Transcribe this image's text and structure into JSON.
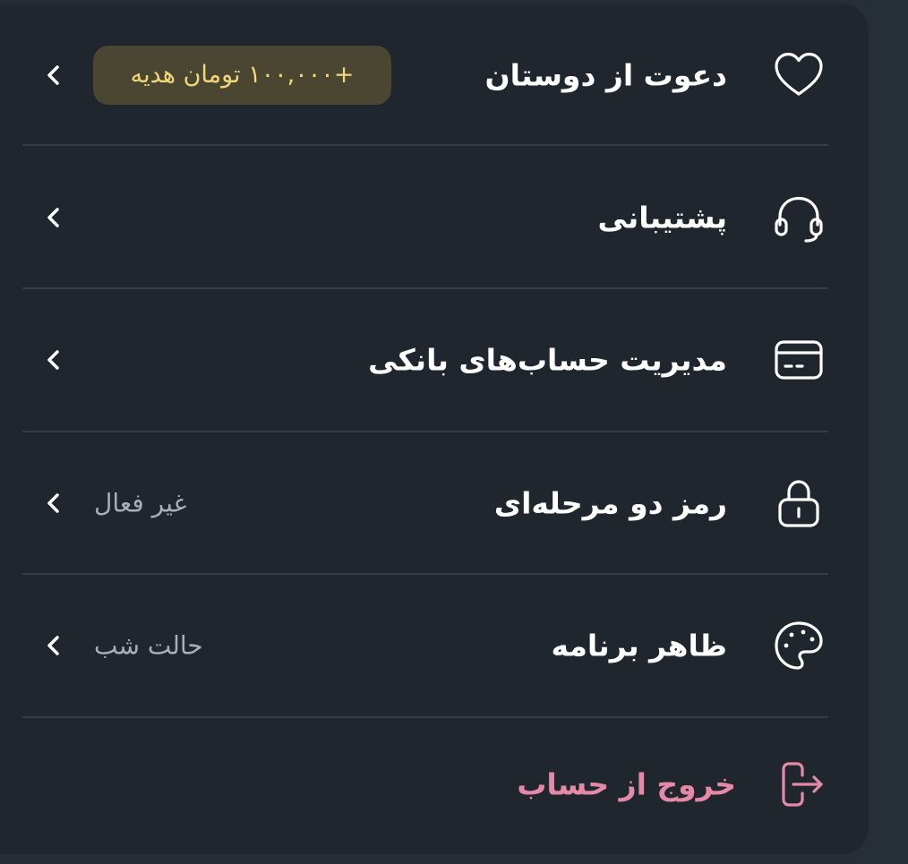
{
  "menu": {
    "items": [
      {
        "label": "دعوت از دوستان",
        "badge": "+۱۰۰,۰۰۰ تومان هدیه",
        "icon": "heart-icon"
      },
      {
        "label": "پشتیبانی",
        "icon": "headset-icon"
      },
      {
        "label": "مدیریت حساب‌های بانکی",
        "icon": "card-icon"
      },
      {
        "label": "رمز دو مرحله‌ای",
        "value": "غیر فعال",
        "icon": "lock-icon"
      },
      {
        "label": "ظاهر برنامه",
        "value": "حالت شب",
        "icon": "palette-icon"
      }
    ],
    "logout": {
      "label": "خروج از حساب",
      "icon": "logout-icon"
    }
  },
  "colors": {
    "panel": "#1f262e",
    "background": "#262e37",
    "text": "#ffffff",
    "muted": "#a7b0ba",
    "badge_bg": "#4a4631",
    "badge_text": "#f0d77a",
    "logout": "#e48aa6",
    "divider": "#343d46"
  }
}
